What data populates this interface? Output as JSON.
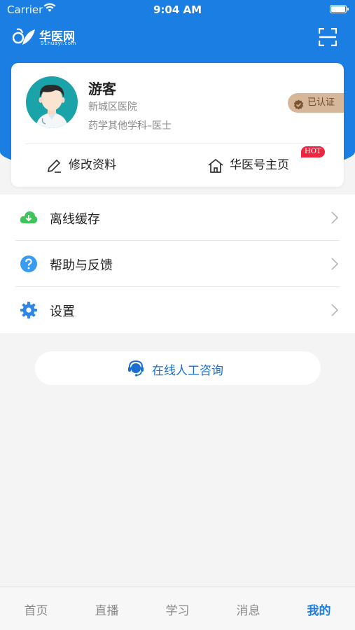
{
  "status_bar": {
    "carrier": "Carrier",
    "time": "9:04 AM"
  },
  "header": {
    "logo_name": "华医网",
    "logo_domain": "91huayi.com"
  },
  "profile": {
    "name": "游客",
    "hospital": "新城区医院",
    "department": "药学其他学科–医士",
    "verified_label": "已认证",
    "edit_label": "修改资料",
    "homepage_label": "华医号主页",
    "hot_badge": "HOT"
  },
  "menu": {
    "items": [
      {
        "label": "离线缓存",
        "icon": "cloud-download-icon",
        "color": "#3fc45a"
      },
      {
        "label": "帮助与反馈",
        "icon": "question-icon",
        "color": "#3a9cf0"
      },
      {
        "label": "设置",
        "icon": "gear-icon",
        "color": "#2f86e6"
      }
    ]
  },
  "consult": {
    "label": "在线人工咨询"
  },
  "tabs": {
    "items": [
      {
        "label": "首页"
      },
      {
        "label": "直播"
      },
      {
        "label": "学习"
      },
      {
        "label": "消息"
      },
      {
        "label": "我的"
      }
    ],
    "active_index": 4
  },
  "colors": {
    "brand_blue": "#1a7ee3",
    "hot_red": "#f0253f",
    "badge_tan": "#d6b79a"
  }
}
